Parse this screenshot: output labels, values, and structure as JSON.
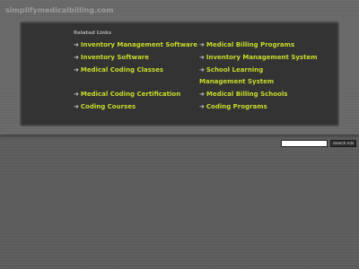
{
  "header": {
    "domain": "simplifymedicalbilling.com"
  },
  "related": {
    "title": "Related Links",
    "arrow": "➔",
    "left": [
      "Inventory Management Software",
      "Inventory Software",
      "Medical Coding Classes",
      "Medical Coding Certification",
      "Coding Courses"
    ],
    "right": [
      "Medical Billing Programs",
      "Inventory Management System",
      "School Learning Management System",
      "Medical Billing Schools",
      "Coding Programs"
    ]
  },
  "search": {
    "value": "",
    "button_label": "Search Ads"
  },
  "colors": {
    "link": "#c8dc2a",
    "panel": "#333333",
    "background": "#5f5f5f"
  }
}
